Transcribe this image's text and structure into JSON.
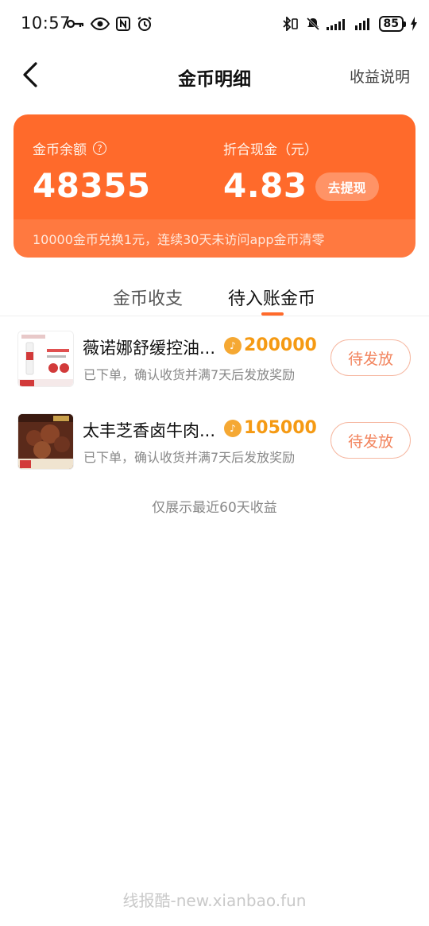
{
  "status_bar": {
    "time": "10:57",
    "battery": "85",
    "left_icons": [
      "key-icon",
      "eye-icon",
      "nfc-icon",
      "alarm-icon"
    ],
    "right_icons": [
      "bluetooth-vibrate-icon",
      "mute-icon",
      "signal-icon",
      "signal-icon",
      "battery-icon",
      "charging-icon"
    ]
  },
  "nav": {
    "title": "金币明细",
    "right_link": "收益说明"
  },
  "balance_card": {
    "coin_label": "金币余额",
    "coin_value": "48355",
    "cash_label": "折合现金（元）",
    "cash_value": "4.83",
    "withdraw_label": "去提现",
    "footer_note": "10000金币兑换1元，连续30天未访问app金币清零",
    "color": "#ff6a2b"
  },
  "tabs": [
    {
      "label": "金币收支",
      "active": false
    },
    {
      "label": "待入账金币",
      "active": true
    }
  ],
  "items": [
    {
      "title": "薇诺娜舒缓控油...",
      "amount": "200000",
      "subtitle": "已下单，确认收货并满7天后发放奖励",
      "status_label": "待发放"
    },
    {
      "title": "太丰芝香卤牛肉...",
      "amount": "105000",
      "subtitle": "已下单，确认收货并满7天后发放奖励",
      "status_label": "待发放"
    }
  ],
  "footnote": "仅展示最近60天收益",
  "watermark": "线报酷-new.xianbao.fun",
  "colors": {
    "accent": "#ff6a2b",
    "coin_amount": "#f59a13",
    "pending_text": "#f2835c"
  }
}
